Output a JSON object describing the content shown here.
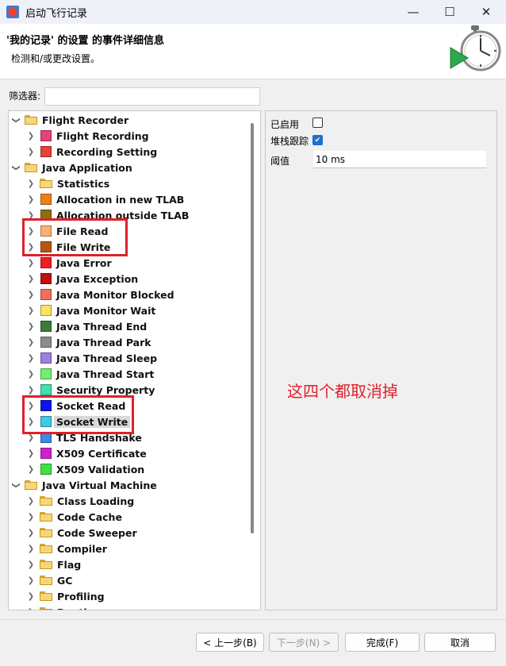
{
  "window": {
    "title": "启动飞行记录"
  },
  "header": {
    "title": "'我的记录' 的设置 的事件详细信息",
    "description": "检测和/或更改设置。"
  },
  "filter": {
    "label": "筛选器:",
    "value": ""
  },
  "tree": {
    "groups": [
      {
        "label": "Flight Recorder",
        "items": [
          {
            "label": "Flight Recording",
            "color": "#e8407a"
          },
          {
            "label": "Recording Setting",
            "color": "#e8403a"
          }
        ]
      },
      {
        "label": "Java Application",
        "items": [
          {
            "label": "Statistics",
            "folder": true
          },
          {
            "label": "Allocation in new TLAB",
            "color": "#f07e1a"
          },
          {
            "label": "Allocation outside TLAB",
            "color": "#8a6e10"
          },
          {
            "label": "File Read",
            "color": "#ffb06e"
          },
          {
            "label": "File Write",
            "color": "#b85414"
          },
          {
            "label": "Java Error",
            "color": "#f01e1e"
          },
          {
            "label": "Java Exception",
            "color": "#c20f0f"
          },
          {
            "label": "Java Monitor Blocked",
            "color": "#f0705a"
          },
          {
            "label": "Java Monitor Wait",
            "color": "#ffe060"
          },
          {
            "label": "Java Thread End",
            "color": "#3c7a3c"
          },
          {
            "label": "Java Thread Park",
            "color": "#8c8c8c"
          },
          {
            "label": "Java Thread Sleep",
            "color": "#9b80e0"
          },
          {
            "label": "Java Thread Start",
            "color": "#70f070"
          },
          {
            "label": "Security Property",
            "color": "#40e0b0"
          },
          {
            "label": "Socket Read",
            "color": "#1010f0"
          },
          {
            "label": "Socket Write",
            "color": "#40c8e8"
          },
          {
            "label": "TLS Handshake",
            "color": "#3a8ae8"
          },
          {
            "label": "X509 Certificate",
            "color": "#d020d0"
          },
          {
            "label": "X509 Validation",
            "color": "#40e040"
          }
        ]
      },
      {
        "label": "Java Virtual Machine",
        "items": [
          {
            "label": "Class Loading",
            "folder": true
          },
          {
            "label": "Code Cache",
            "folder": true
          },
          {
            "label": "Code Sweeper",
            "folder": true
          },
          {
            "label": "Compiler",
            "folder": true
          },
          {
            "label": "Flag",
            "folder": true
          },
          {
            "label": "GC",
            "folder": true
          },
          {
            "label": "Profiling",
            "folder": true
          },
          {
            "label": "Runtime",
            "folder": true
          }
        ]
      }
    ]
  },
  "settings": {
    "enabled_label": "已启用",
    "enabled": false,
    "stacktrace_label": "堆栈跟踪",
    "stacktrace": true,
    "threshold_label": "阈值",
    "threshold_value": "10 ms"
  },
  "annotation": {
    "text": "这四个都取消掉",
    "color": "#e0202c"
  },
  "footer": {
    "back": "< 上一步(B)",
    "next": "下一步(N) >",
    "finish": "完成(F)",
    "cancel": "取消"
  }
}
